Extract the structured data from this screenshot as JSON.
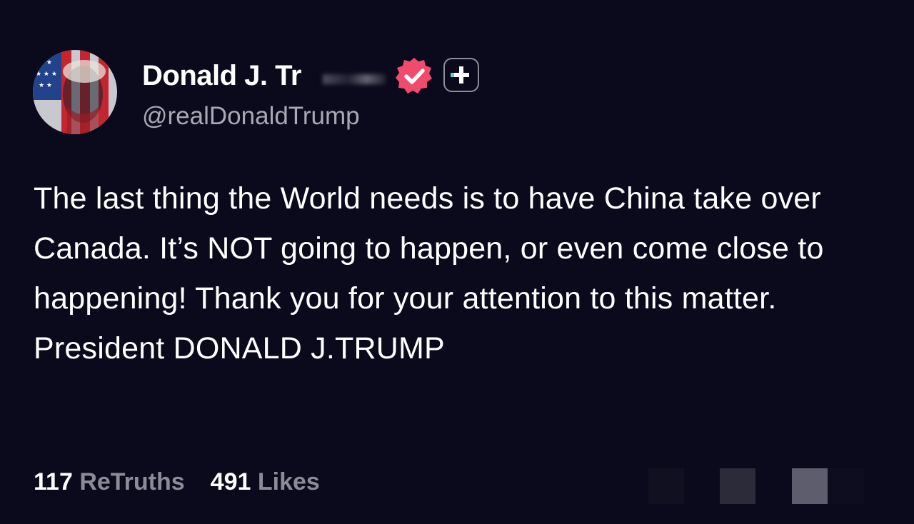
{
  "post": {
    "author": {
      "display_name": "Donald J. Tr",
      "handle": "@realDonaldTrump",
      "avatar": "flag-portrait-avatar",
      "verified_icon": "verified-badge-icon",
      "plus_icon": "plus-icon"
    },
    "body": "The last thing the World needs is to have China take over Canada. It’s NOT going to happen, or even come close to happening! Thank you for your attention to this matter. President DONALD J.TRUMP",
    "stats": {
      "retruths_count": "117",
      "retruths_label": "ReTruths",
      "likes_count": "491",
      "likes_label": "Likes"
    }
  },
  "colors": {
    "background": "#0b0a1d",
    "verified": "#f04a6c",
    "muted_text": "#a9a8b3",
    "stat_label": "#8c8b96"
  }
}
